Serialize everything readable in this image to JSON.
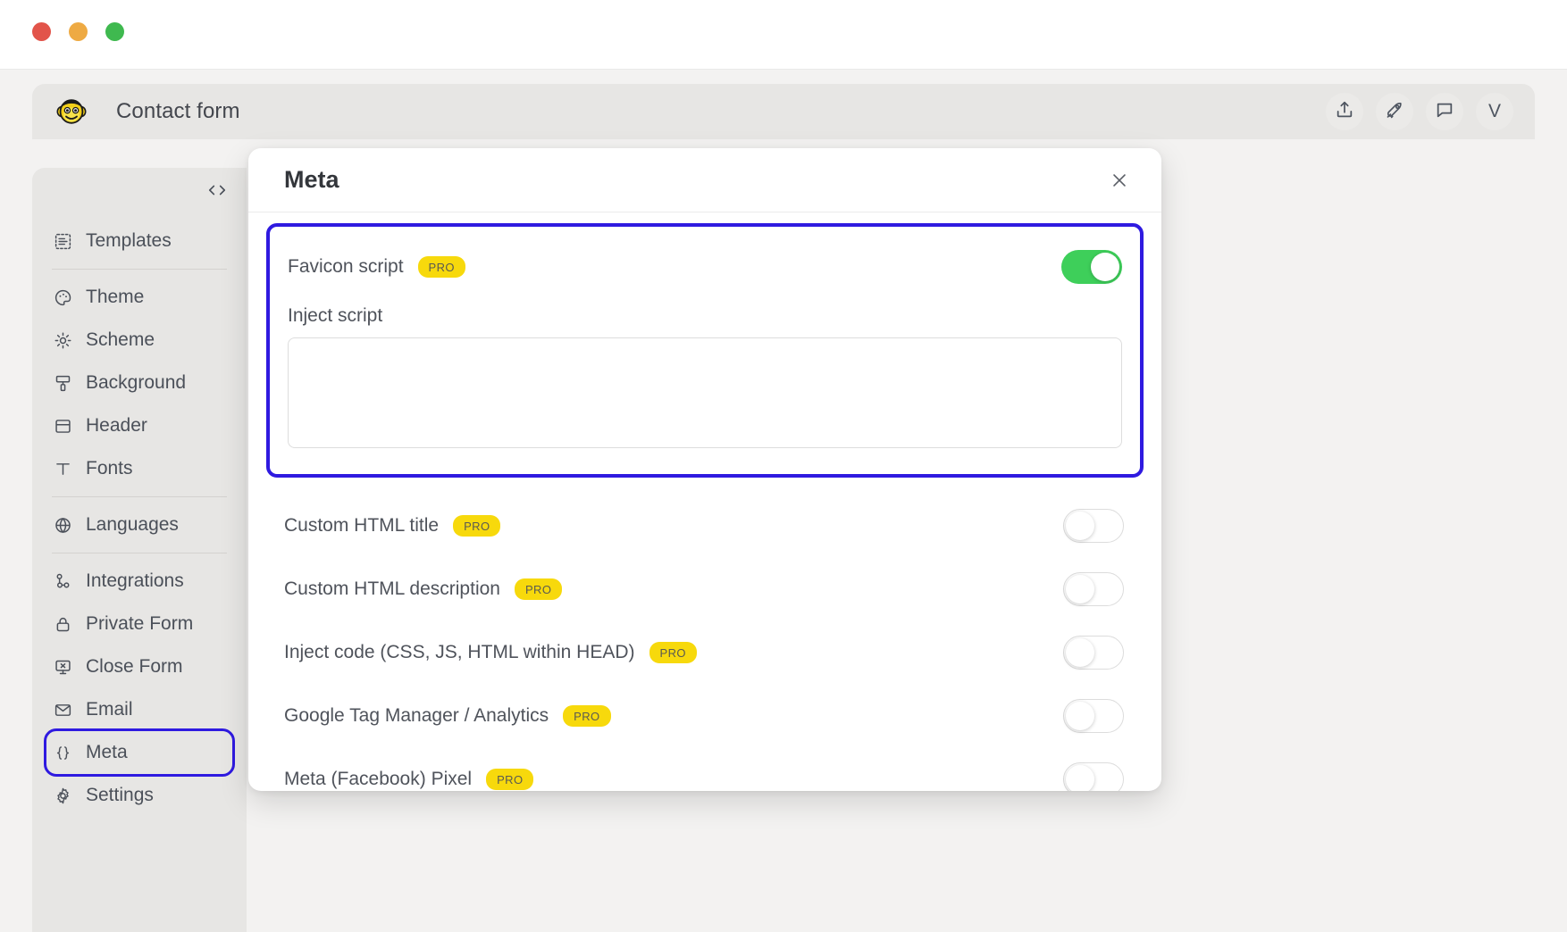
{
  "window": {
    "traffic_lights": [
      "close",
      "minimize",
      "maximize"
    ],
    "colors": {
      "close": "#e2544a",
      "minimize": "#eeaa43",
      "maximize": "#3fb94f"
    }
  },
  "topbar": {
    "logo_icon": "monkey-face-logo",
    "title": "Contact form",
    "actions": [
      {
        "icon": "upload-icon",
        "name": "share-export-button"
      },
      {
        "icon": "rocket-icon",
        "name": "publish-button"
      },
      {
        "icon": "comment-icon",
        "name": "comments-button"
      }
    ],
    "avatar_initial": "V"
  },
  "sidebar": {
    "collapse_icon": "code-brackets-icon",
    "items": [
      {
        "label": "Templates",
        "icon": "templates-icon",
        "selected": false,
        "highlighted": false
      },
      {
        "label": "Theme",
        "icon": "palette-icon",
        "selected": false,
        "highlighted": false
      },
      {
        "label": "Scheme",
        "icon": "sun-icon",
        "selected": false,
        "highlighted": false
      },
      {
        "label": "Background",
        "icon": "paint-roller-icon",
        "selected": false,
        "highlighted": false
      },
      {
        "label": "Header",
        "icon": "header-layout-icon",
        "selected": false,
        "highlighted": false
      },
      {
        "label": "Fonts",
        "icon": "text-type-icon",
        "selected": false,
        "highlighted": false
      },
      {
        "label": "Languages",
        "icon": "globe-icon",
        "selected": false,
        "highlighted": false
      },
      {
        "label": "Integrations",
        "icon": "nodes-icon",
        "selected": false,
        "highlighted": false
      },
      {
        "label": "Private Form",
        "icon": "lock-icon",
        "selected": false,
        "highlighted": false
      },
      {
        "label": "Close Form",
        "icon": "monitor-x-icon",
        "selected": false,
        "highlighted": false
      },
      {
        "label": "Email",
        "icon": "envelope-icon",
        "selected": false,
        "highlighted": false
      },
      {
        "label": "Meta",
        "icon": "curly-braces-icon",
        "selected": true,
        "highlighted": true
      },
      {
        "label": "Settings",
        "icon": "gear-icon",
        "selected": false,
        "highlighted": false
      }
    ]
  },
  "modal": {
    "title": "Meta",
    "close_icon": "close-icon",
    "highlight_color": "#2f1ae0",
    "highlighted_group": {
      "favicon": {
        "label": "Favicon script",
        "badge": "PRO",
        "toggle_state": "on"
      },
      "inject_script": {
        "label": "Inject script",
        "value": "",
        "placeholder": ""
      }
    },
    "rows": [
      {
        "label": "Custom HTML title",
        "badge": "PRO",
        "toggle_state": "off"
      },
      {
        "label": "Custom HTML description",
        "badge": "PRO",
        "toggle_state": "off"
      },
      {
        "label": "Inject code (CSS, JS, HTML within HEAD)",
        "badge": "PRO",
        "toggle_state": "off"
      },
      {
        "label": "Google Tag Manager / Analytics",
        "badge": "PRO",
        "toggle_state": "off"
      },
      {
        "label": "Meta (Facebook) Pixel",
        "badge": "PRO",
        "toggle_state": "off"
      }
    ]
  },
  "colors": {
    "toggle_on": "#3ecf5a",
    "pro_badge": "#f7d90c",
    "highlight_outline": "#2f1ae0",
    "app_bg": "#f3f2f1",
    "panel_bg": "#e7e6e4"
  }
}
